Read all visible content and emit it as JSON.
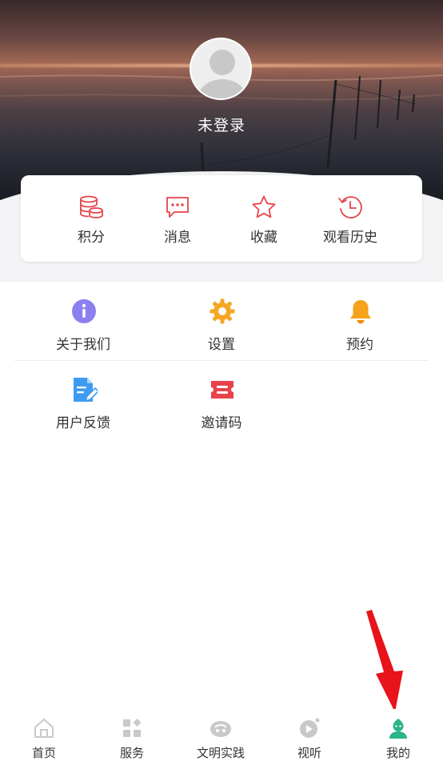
{
  "profile": {
    "login_text": "未登录"
  },
  "quick_actions": [
    {
      "label": "积分",
      "icon": "coins-stack-icon"
    },
    {
      "label": "消息",
      "icon": "message-icon"
    },
    {
      "label": "收藏",
      "icon": "star-icon"
    },
    {
      "label": "观看历史",
      "icon": "history-clock-icon"
    }
  ],
  "menu": [
    {
      "label": "关于我们",
      "icon": "info-icon"
    },
    {
      "label": "设置",
      "icon": "gear-icon"
    },
    {
      "label": "预约",
      "icon": "bell-icon"
    },
    {
      "label": "用户反馈",
      "icon": "feedback-doc-icon"
    },
    {
      "label": "邀请码",
      "icon": "ticket-icon"
    }
  ],
  "tabbar": [
    {
      "label": "首页",
      "icon": "home-icon",
      "active": false
    },
    {
      "label": "服务",
      "icon": "services-grid-icon",
      "active": false
    },
    {
      "label": "文明实践",
      "icon": "practice-icon",
      "active": false
    },
    {
      "label": "视听",
      "icon": "video-play-icon",
      "active": false
    },
    {
      "label": "我的",
      "icon": "user-icon",
      "active": true
    }
  ],
  "colors": {
    "accent_red": "#e8434a",
    "active_green": "#2bb38a",
    "inactive_gray": "#c9c9c9",
    "info_purple": "#8c7ff0",
    "gear_orange": "#f5a623",
    "bell_orange": "#f7a21b",
    "feedback_blue": "#3f9bf0",
    "annotation_red": "#e8131b"
  }
}
